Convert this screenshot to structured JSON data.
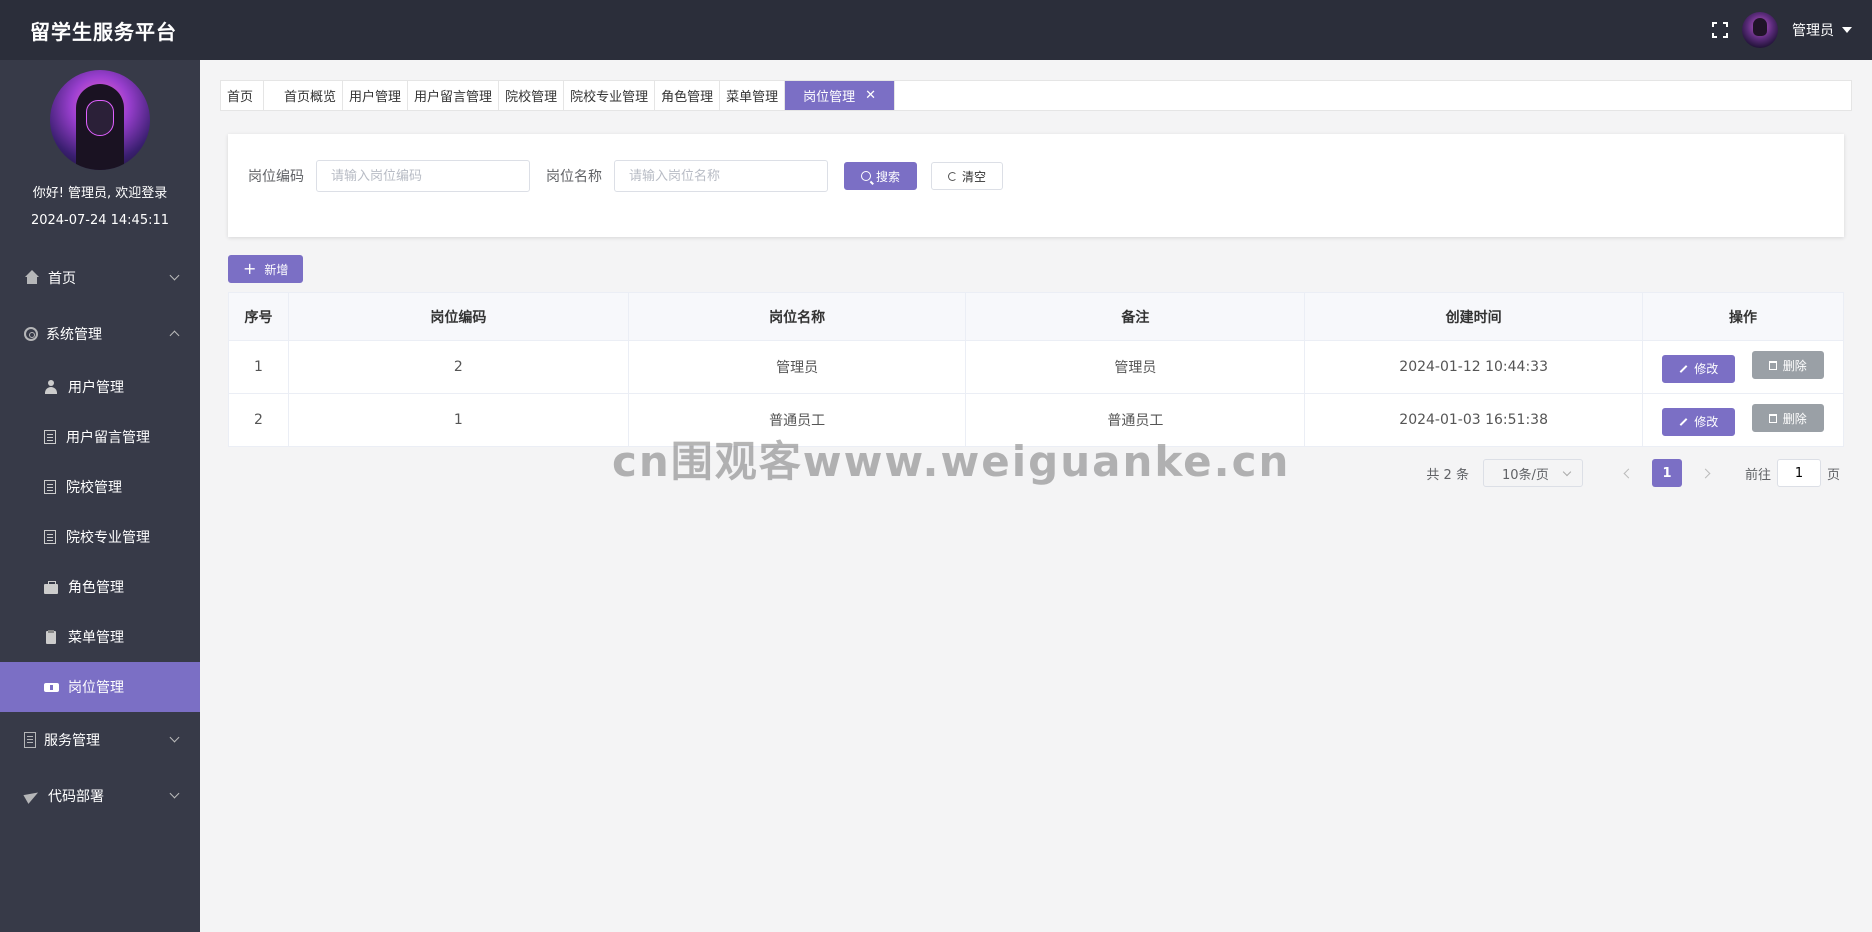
{
  "header": {
    "brand": "留学生服务平台",
    "username": "管理员"
  },
  "sidebar": {
    "welcome": "你好! 管理员, 欢迎登录",
    "datetime": "2024-07-24 14:45:11",
    "menu": {
      "home": "首页",
      "system": "系统管理",
      "sub": [
        "用户管理",
        "用户留言管理",
        "院校管理",
        "院校专业管理",
        "角色管理",
        "菜单管理",
        "岗位管理"
      ],
      "service": "服务管理",
      "deploy": "代码部署"
    }
  },
  "tabs": [
    "首页",
    "首页概览",
    "用户管理",
    "用户留言管理",
    "院校管理",
    "院校专业管理",
    "角色管理",
    "菜单管理",
    "岗位管理"
  ],
  "search": {
    "code_label": "岗位编码",
    "code_placeholder": "请输入岗位编码",
    "name_label": "岗位名称",
    "name_placeholder": "请输入岗位名称",
    "search_btn": "搜索",
    "clear_btn": "清空"
  },
  "toolbar": {
    "add_btn": "新增"
  },
  "table": {
    "headers": [
      "序号",
      "岗位编码",
      "岗位名称",
      "备注",
      "创建时间",
      "操作"
    ],
    "rows": [
      [
        "1",
        "2",
        "管理员",
        "管理员",
        "2024-01-12 10:44:33"
      ],
      [
        "2",
        "1",
        "普通员工",
        "普通员工",
        "2024-01-03 16:51:38"
      ]
    ],
    "edit_btn": "修改",
    "delete_btn": "删除"
  },
  "pagination": {
    "total": "共 2 条",
    "page_size": "10条/页",
    "current": "1",
    "goto_label": "前往",
    "goto_value": "1",
    "page_suffix": "页"
  },
  "watermark": "cn围观客www.weiguanke.cn",
  "colors": {
    "accent": "#7b6fc5",
    "header": "#2b2e3a",
    "sidebar": "#373a48"
  }
}
